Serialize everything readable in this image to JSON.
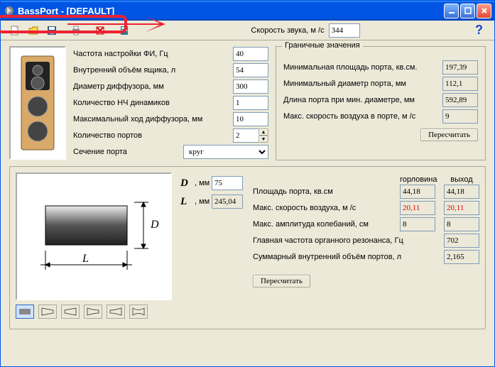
{
  "title": "BassPort - [DEFAULT]",
  "sound_speed": {
    "label": "Скорость звука, м /с",
    "value": "344"
  },
  "params": {
    "tuning_freq": {
      "label": "Частота настройки ФИ, Гц",
      "value": "40"
    },
    "box_volume": {
      "label": "Внутренний объём ящика, л",
      "value": "54"
    },
    "cone_diam": {
      "label": "Диаметр диффузора, мм",
      "value": "300"
    },
    "driver_count": {
      "label": "Количество НЧ динамиков",
      "value": "1"
    },
    "max_excursion": {
      "label": "Максимальный ход диффузора, мм",
      "value": "10"
    },
    "port_count": {
      "label": "Количество портов",
      "value": "2"
    },
    "port_shape": {
      "label": "Сечение порта",
      "value": "круг"
    }
  },
  "limits": {
    "legend": "Граничные значения",
    "min_port_area": {
      "label": "Минимальная площадь порта, кв.см.",
      "value": "197,39"
    },
    "min_port_diam": {
      "label": "Минимальный диаметр порта, мм",
      "value": "112,1"
    },
    "len_at_min_diam": {
      "label": "Длина порта при мин. диаметре, мм",
      "value": "592,89"
    },
    "max_air_speed": {
      "label": "Макс. скорость воздуха в порте, м /с",
      "value": "9"
    },
    "recalc": "Пересчитать"
  },
  "dl": {
    "d_unit": ", мм",
    "d_value": "75",
    "l_unit": ", мм",
    "l_value": "245,04"
  },
  "results": {
    "col1": "горловина",
    "col2": "выход",
    "port_area": {
      "label": "Площадь порта, кв.см",
      "v1": "44,18",
      "v2": "44,18"
    },
    "max_air": {
      "label": "Макс. скорость воздуха, м /с",
      "v1": "20,11",
      "v2": "20,11"
    },
    "max_ampl": {
      "label": "Макс. амплитуда колебаний, см",
      "v1": "8",
      "v2": "8"
    },
    "organ_freq": {
      "label": "Главная частота органного резонанса, Гц",
      "v": "702"
    },
    "total_vol": {
      "label": "Суммарный внутренний объём портов, л",
      "v": "2,165"
    },
    "recalc": "Пересчитать"
  }
}
